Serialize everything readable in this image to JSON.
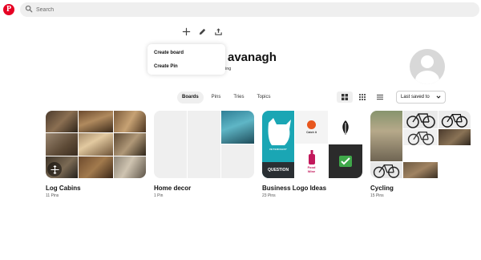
{
  "header": {
    "logo_icon": "pinterest-logo",
    "logo_text": "P",
    "search": {
      "placeholder": "Search",
      "icon": "search-icon"
    }
  },
  "profile_actions": {
    "icons": [
      "plus-icon",
      "pencil-icon",
      "share-icon"
    ]
  },
  "create_menu": {
    "items": [
      "Create board",
      "Create Pin"
    ]
  },
  "profile": {
    "name_partial": "avanagh",
    "sub_partial": "ing",
    "avatar_icon": "default-avatar"
  },
  "tabs": [
    {
      "label": "Boards",
      "active": true
    },
    {
      "label": "Pins",
      "active": false
    },
    {
      "label": "Tries",
      "active": false
    },
    {
      "label": "Topics",
      "active": false
    }
  ],
  "view_toggles": [
    "grid-large-icon",
    "grid-small-icon",
    "list-icon"
  ],
  "sort": {
    "label": "Last saved to",
    "icon": "chevron-down-icon"
  },
  "boards": [
    {
      "title": "Log Cabins",
      "count": "11 Pins"
    },
    {
      "title": "Home decor",
      "count": "1 Pin"
    },
    {
      "title": "Business Logo Ideas",
      "count": "23 Pins"
    },
    {
      "title": "Cycling",
      "count": "15 Pins"
    }
  ],
  "logo_tiles": {
    "catch": "Catch it",
    "food": "Food Wine",
    "question": "QUESTION",
    "veterinary": "VETERINARY"
  },
  "colors": {
    "brand": "#e60023",
    "tab_active_bg": "#efefef",
    "search_bg": "#efefef"
  }
}
